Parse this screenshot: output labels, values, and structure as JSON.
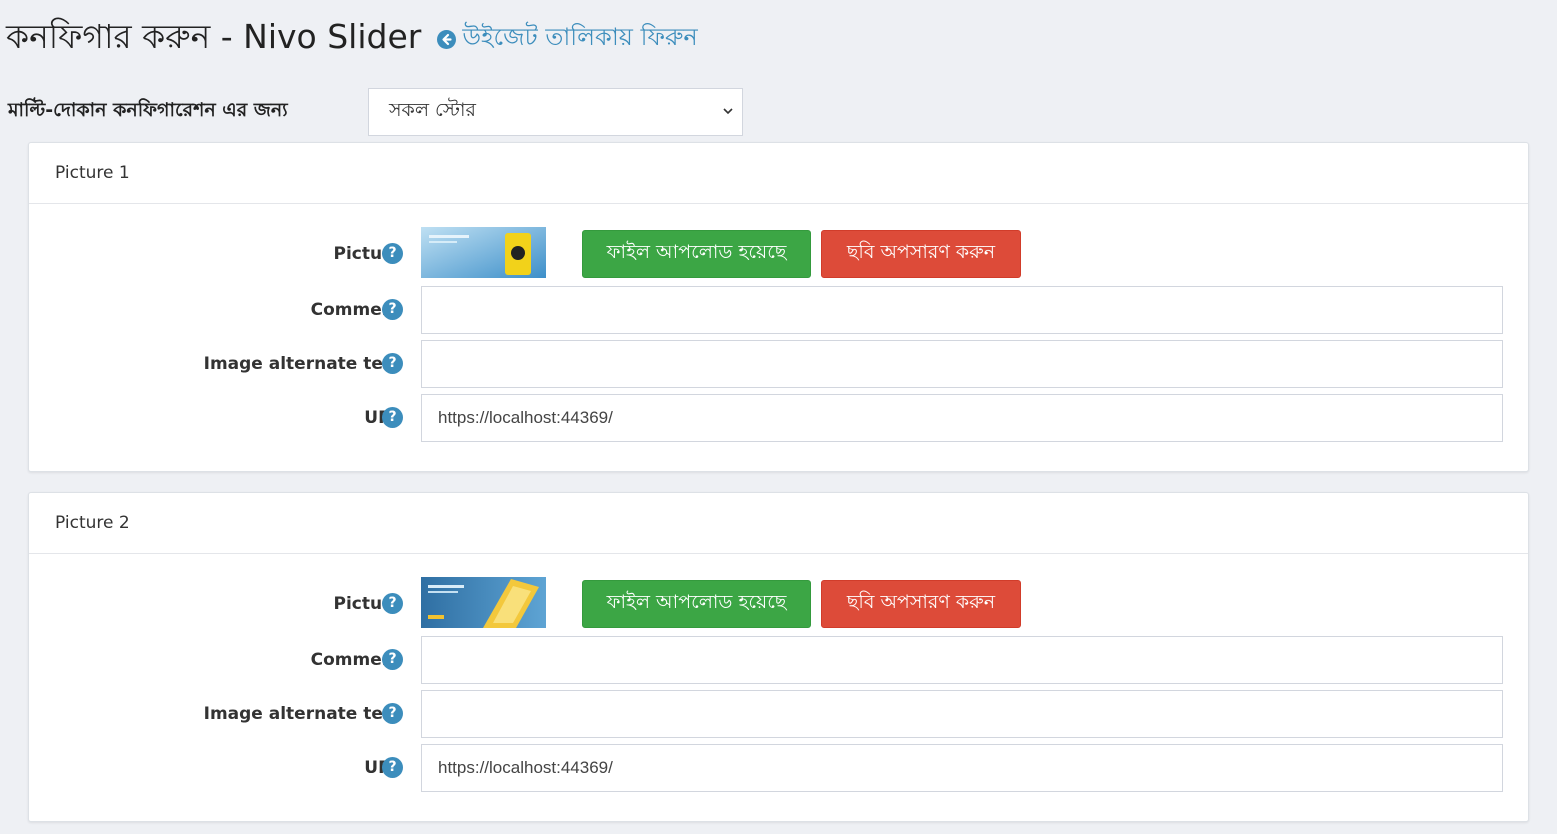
{
  "header": {
    "title": "কনফিগার করুন - Nivo Slider",
    "back_link": "উইজেট তালিকায় ফিরুন",
    "back_icon": "arrow-circle-left-icon"
  },
  "store_scope": {
    "label": "মাল্টি-দোকান কনফিগারেশন এর জন্য",
    "selected": "সকল স্টোর"
  },
  "pictures": [
    {
      "header": "Picture 1",
      "picture_label": "Picture",
      "upload_button": "ফাইল আপলোড হয়েছে",
      "remove_button": "ছবি অপসারণ করুন",
      "comment_label": "Comment",
      "comment_value": "",
      "alt_label": "Image alternate text",
      "alt_value": "",
      "url_label": "URL",
      "url_value": "https://localhost:44369/"
    },
    {
      "header": "Picture 2",
      "picture_label": "Picture",
      "upload_button": "ফাইল আপলোড হয়েছে",
      "remove_button": "ছবি অপসারণ করুন",
      "comment_label": "Comment",
      "comment_value": "",
      "alt_label": "Image alternate text",
      "alt_value": "",
      "url_label": "URL",
      "url_value": "https://localhost:44369/"
    }
  ],
  "help_glyph": "?",
  "colors": {
    "accent": "#3c8dbc",
    "success": "#3ca645",
    "danger": "#dd4b39"
  }
}
